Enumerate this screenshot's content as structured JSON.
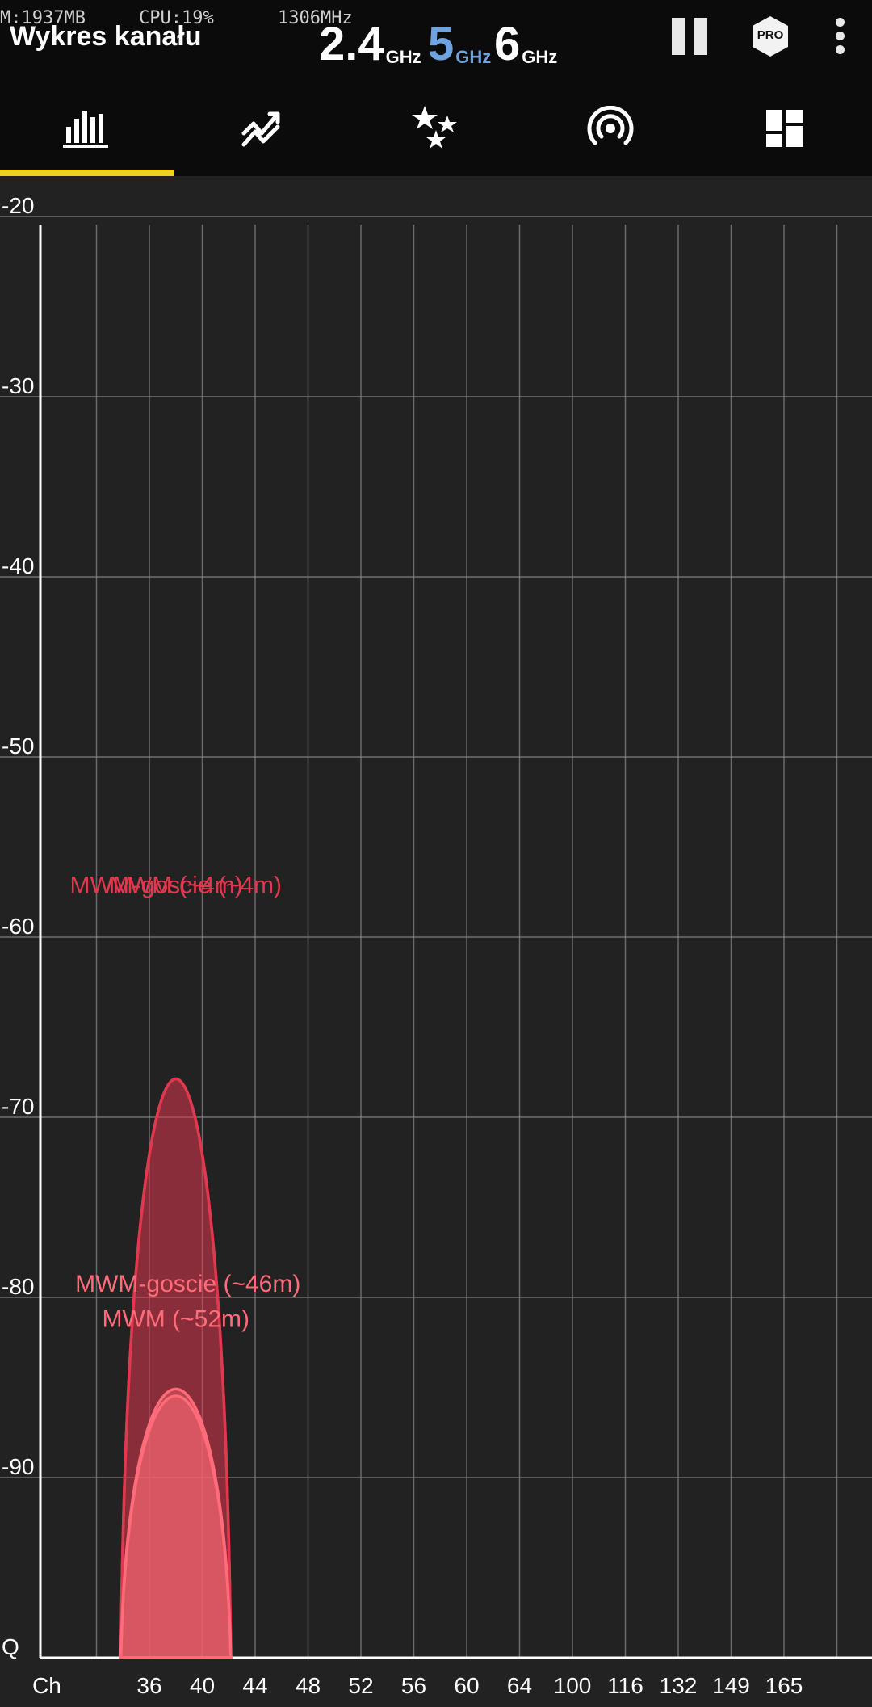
{
  "status_bar": {
    "memory": "M:1937MB",
    "cpu": "CPU:19%",
    "frequency": "1306MHz"
  },
  "header": {
    "title": "Wykres kanału",
    "bands": [
      {
        "value": "2.4",
        "unit": "GHz",
        "active": false
      },
      {
        "value": "5",
        "unit": "GHz",
        "active": true
      },
      {
        "value": "6",
        "unit": "GHz",
        "active": false
      }
    ],
    "pro_label": "PRO",
    "icons": {
      "pause": "pause-icon",
      "pro": "pro-badge-icon",
      "menu": "more-vert-icon"
    }
  },
  "tabs": [
    {
      "name": "channel-graph",
      "icon": "bar-chart-icon",
      "active": true
    },
    {
      "name": "time-graph",
      "icon": "trend-chart-icon",
      "active": false
    },
    {
      "name": "channel-rating",
      "icon": "stars-icon",
      "active": false
    },
    {
      "name": "ap-list",
      "icon": "wifi-signal-icon",
      "active": false
    },
    {
      "name": "dashboard",
      "icon": "dashboard-icon",
      "active": false
    }
  ],
  "colors": {
    "accent": "#f4cf1b",
    "band_active": "#6fa3e0",
    "grid": "#8a8a8a",
    "series_strong": "#e0384e",
    "series_weak": "#ff6b78"
  },
  "chart_data": {
    "type": "area",
    "y_ticks": [
      "-20",
      "-30",
      "-40",
      "-50",
      "-60",
      "-70",
      "-80",
      "-90",
      "Q"
    ],
    "y_values": [
      -20,
      -30,
      -40,
      -50,
      -60,
      -70,
      -80,
      -90,
      -100
    ],
    "ylim": [
      -100,
      -20
    ],
    "x_axis_label": "Ch",
    "x_ticks": [
      "36",
      "40",
      "44",
      "48",
      "52",
      "56",
      "60",
      "64",
      "100",
      "116",
      "132",
      "149",
      "165"
    ],
    "grid": true,
    "series": [
      {
        "name": "MWM (~4m)",
        "label": "MWM (~4m)",
        "center_channel": 38,
        "width_mhz": 40,
        "signal_dbm": -58,
        "color": "#e0384e"
      },
      {
        "name": "MWM-goscie (~4m)",
        "label": "MWM-goscie (~4m)",
        "center_channel": 38,
        "width_mhz": 40,
        "signal_dbm": -58,
        "color": "#e0384e"
      },
      {
        "name": "MWM-goscie (~46m)",
        "label": "MWM-goscie (~46m)",
        "center_channel": 38,
        "width_mhz": 40,
        "signal_dbm": -80.5,
        "color": "#ff6b78"
      },
      {
        "name": "MWM (~52m)",
        "label": "MWM (~52m)",
        "center_channel": 38,
        "width_mhz": 40,
        "signal_dbm": -81,
        "color": "#ff6b78"
      }
    ]
  }
}
